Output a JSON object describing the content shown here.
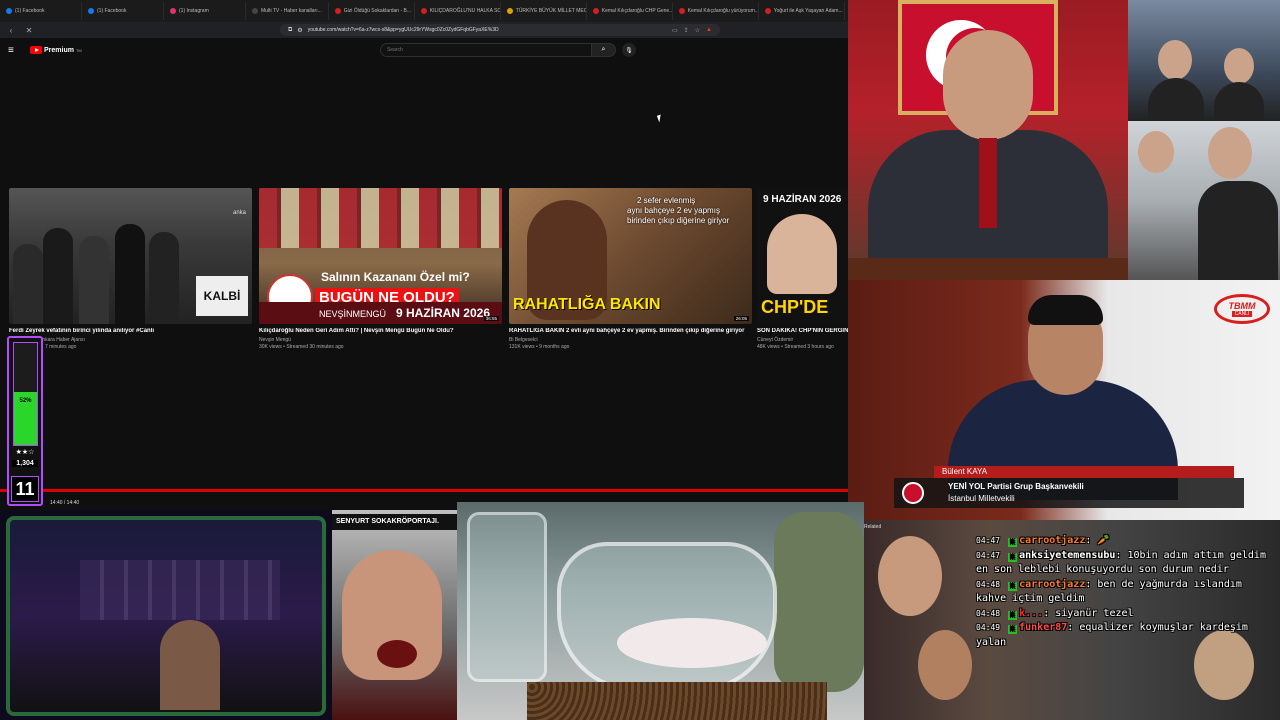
{
  "browser": {
    "tabs": [
      {
        "label": "(1) Facebook",
        "color": "#1877f2"
      },
      {
        "label": "(1) Facebook",
        "color": "#1877f2"
      },
      {
        "label": "(1) Instagram",
        "color": "#e1306c"
      },
      {
        "label": "Multi TV - Haber kanalları...",
        "color": "#444444"
      },
      {
        "label": "Gizi Öldüğü Sokaklardan - B...",
        "color": "#d02020"
      },
      {
        "label": "KILIÇDAROĞLU'NU HALKA SO...",
        "color": "#d02020"
      },
      {
        "label": "TÜRKİYE BÜYÜK MİLLET MECL...",
        "color": "#e0a000"
      },
      {
        "label": "Kemal Kılıçdaroğlu CHP Gene...",
        "color": "#d02020"
      },
      {
        "label": "Kemal Kılıçdaroğlu yürüyorum...",
        "color": "#d02020"
      },
      {
        "label": "Yoğurt ile Aşk Yaşayan Adam...",
        "color": "#d02020"
      }
    ],
    "url": "youtube.com/watch?v=6a-z7wcx-s8&pp=ygUUc29rYWsgc0Zc0ZydGFqbGFyaXE%3D"
  },
  "youtube": {
    "brand": "Premium",
    "brand_tm": "TM",
    "search_placeholder": "Search",
    "timecode": "14:40 / 14:40",
    "end_screen": [
      {
        "title": "Ferdi Zeyrek vefatının birinci yılında anılıyor #Canlı",
        "channel": "Ankara Haber Ajansı",
        "meta": "7 minutes ago",
        "thumb_text": "KALBİ",
        "thumb_badge": "anka",
        "duration": ""
      },
      {
        "title": "Kılıçdaroğlu Neden Geri Adım Attı? | Nevşin Mengü Bugün Ne Oldu?",
        "channel": "Nevşin Mengü",
        "meta": "30K views • Streamed 30 minutes ago",
        "thumb_title": "Salının Kazananı Özel mi?",
        "thumb_sub": "BUGÜN NE OLDU?",
        "thumb_name": "NEVŞİNMENGÜ",
        "thumb_date": "9 HAZİRAN 2026",
        "duration": "36:55"
      },
      {
        "title": "RAHATLIĞA BAKIN 2 evli aynı bahçeye 2 ev yapmış. Birinden çıkıp diğerine giriyor",
        "channel": "Bi Belgeselci",
        "meta": "131K views • 9 months ago",
        "thumb_text_1": "2 sefer evlenmiş",
        "thumb_text_2": "aynı bahçeye 2 ev yapmış",
        "thumb_text_3": "birinden çıkıp diğerine giriyor",
        "thumb_big": "RAHATLIĞA BAKIN",
        "duration": "26:05"
      },
      {
        "title": "SON DAKİKA! CHP'NİN GERGİN GÜNÜ! KILIÇDAROĞLU ATTI! GRUP TOPLANTISI ÖZEL",
        "channel": "Cüneyt Özdemir",
        "meta": "48K views • Streamed 3 hours ago",
        "thumb_date": "9 HAZİRAN 2026",
        "thumb_big": "CHP'DE",
        "duration": ""
      }
    ],
    "progress": 1.0
  },
  "meter": {
    "percent_label": "52%",
    "percent": 52,
    "stars": "★★☆",
    "count": "1,304",
    "number": "11"
  },
  "parliament": {
    "tv_name": "TBMM",
    "tv_live": "CANLI",
    "speaker_name": "Bülent KAYA",
    "line1": "YENİ YOL Partisi Grup Başkanvekili",
    "line2": "İstanbul Milletvekili"
  },
  "street": {
    "banner": "SENYURT SOKAKRÖPORTAJI."
  },
  "chat": {
    "related_label": "Related",
    "messages": [
      {
        "time": "04:47",
        "user": "carrootjazz",
        "text": "🥕",
        "color": "#ff7a2a"
      },
      {
        "time": "04:47",
        "user": "anksiyetemensubu",
        "text": "10bin adım attım geldim en son leblebi konuşuyordu son durum nedir",
        "color": "#ffffff"
      },
      {
        "time": "04:48",
        "user": "carrootjazz",
        "text": "ben de yağmurda ıslandım kahve içtim geldim",
        "color": "#ff7a2a"
      },
      {
        "time": "04:48",
        "user": "k...",
        "text": "siyanür tezel",
        "color": "#ff2a2a"
      },
      {
        "time": "04:49",
        "user": "funker87",
        "text": "equalizer koymuşlar kardeşim yalan",
        "color": "#ff4a4a"
      }
    ]
  }
}
